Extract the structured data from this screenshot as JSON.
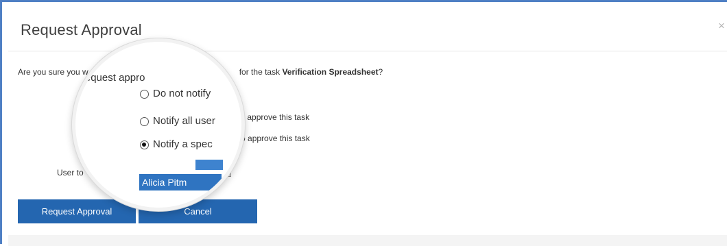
{
  "dialog": {
    "title": "Request Approval",
    "close_glyph": "×",
    "question_prefix": "Are you sure you want to request approval for the task ",
    "task_name": "Verification Spreadsheet",
    "question_suffix": "?",
    "options": [
      {
        "label": "Do not notify anyone",
        "selected": false
      },
      {
        "label": "Notify all users who can approve this task",
        "selected": false
      },
      {
        "label": "Notify a specific user to approve this task",
        "selected": true
      }
    ],
    "user_to_notify_label": "User to notify:",
    "selected_user": "Alicia Pitman"
  },
  "magnifier": {
    "question_fragment": "to request appro",
    "option_fragments": [
      "Do not notify",
      "Notify all user",
      "Notify a spec"
    ],
    "selected_user_fragment": "Alicia Pitm"
  },
  "visible_fragments": {
    "question_left": "Are you sure you w",
    "question_right": "for the task",
    "opt1_tail": "yone",
    "opt2_tail": "ho can approve this task",
    "opt3_tail": "user to approve this task",
    "user_to_visible": "User to"
  },
  "buttons": {
    "approve": "Request Approval",
    "cancel": "Cancel"
  },
  "icons": {
    "close": "close-icon",
    "dropdown": "chevron-down-icon"
  },
  "colors": {
    "button_bg": "#2466b0",
    "selection_bg": "#2f74c1",
    "frame_accent": "#4f7fc4"
  }
}
